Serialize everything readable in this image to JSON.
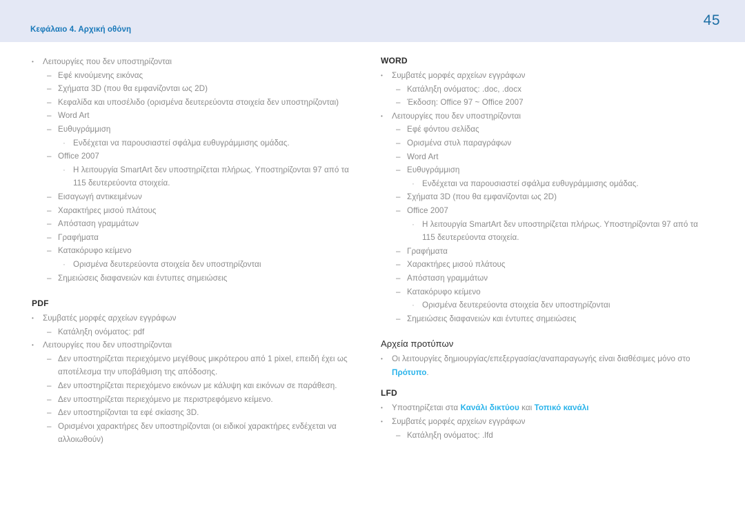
{
  "header": {
    "chapter": "Κεφάλαιο 4. Αρχική οθόνη",
    "page_number": "45",
    "band_color": "#e4e8f5",
    "chapter_color": "#1878b9",
    "page_number_color": "#1c6ea4"
  },
  "colors": {
    "body_text": "#8b8b8b",
    "heading_text": "#2b2b2b",
    "link": "#2ab3ea"
  },
  "left_column": {
    "unsupported_block": {
      "bullet": "Λειτουργίες που δεν υποστηρίζονται",
      "items": [
        "Εφέ κινούμενης εικόνας",
        "Σχήματα 3D (που θα εμφανίζονται ως 2D)",
        "Κεφαλίδα και υποσέλιδο (ορισμένα δευτερεύοντα στοιχεία δεν υποστηρίζονται)",
        "Word Art",
        "Ευθυγράμμιση"
      ],
      "align_note": "Ενδέχεται να παρουσιαστεί σφάλμα ευθυγράμμισης ομάδας.",
      "office": "Office 2007",
      "office_note": "Η λειτουργία SmartArt δεν υποστηρίζεται πλήρως. Υποστηρίζονται 97 από τα 115 δευτερεύοντα στοιχεία.",
      "items_after": [
        "Εισαγωγή αντικειμένων",
        "Χαρακτήρες μισού πλάτους",
        "Απόσταση γραμμάτων",
        "Γραφήματα",
        "Κατακόρυφο κείμενο"
      ],
      "vertical_text_note": "Ορισμένα δευτερεύοντα στοιχεία δεν υποστηρίζονται",
      "last_item": "Σημειώσεις διαφανειών και έντυπες σημειώσεις"
    },
    "pdf": {
      "heading": "PDF",
      "formats_bullet": "Συμβατές μορφές αρχείων εγγράφων",
      "extension": "Κατάληξη ονόματος: pdf",
      "unsupported_bullet": "Λειτουργίες που δεν υποστηρίζονται",
      "unsupported_items": [
        "Δεν υποστηρίζεται περιεχόμενο μεγέθους μικρότερου από 1 pixel, επειδή έχει ως αποτέλεσμα την υποβάθμιση της απόδοσης.",
        "Δεν υποστηρίζεται περιεχόμενο εικόνων με κάλυψη και εικόνων σε παράθεση.",
        "Δεν υποστηρίζεται περιεχόμενο με περιστρεφόμενο κείμενο.",
        "Δεν υποστηρίζονται τα εφέ σκίασης 3D.",
        "Ορισμένοι χαρακτήρες δεν υποστηρίζονται (οι ειδικοί χαρακτήρες ενδέχεται να αλλοιωθούν)"
      ]
    }
  },
  "right_column": {
    "word": {
      "heading": "WORD",
      "formats_bullet": "Συμβατές μορφές αρχείων εγγράφων",
      "extension": "Κατάληξη ονόματος: .doc, .docx",
      "version": "Έκδοση: Office 97 ~ Office 2007",
      "unsupported_bullet": "Λειτουργίες που δεν υποστηρίζονται",
      "items": [
        "Εφέ φόντου σελίδας",
        "Ορισμένα στυλ παραγράφων",
        "Word Art",
        "Ευθυγράμμιση"
      ],
      "align_note": "Ενδέχεται να παρουσιαστεί σφάλμα ευθυγράμμισης ομάδας.",
      "shapes_3d": "Σχήματα 3D (που θα εμφανίζονται ως 2D)",
      "office": "Office 2007",
      "office_note": "Η λειτουργία SmartArt δεν υποστηρίζεται πλήρως. Υποστηρίζονται 97 από τα 115 δευτερεύοντα στοιχεία.",
      "items_after": [
        "Γραφήματα",
        "Χαρακτήρες μισού πλάτους",
        "Απόσταση γραμμάτων",
        "Κατακόρυφο κείμενο"
      ],
      "vertical_text_note": "Ορισμένα δευτερεύοντα στοιχεία δεν υποστηρίζονται",
      "last_item": "Σημειώσεις διαφανειών και έντυπες σημειώσεις"
    },
    "templates": {
      "heading": "Αρχεία προτύπων",
      "bullet_prefix": "Οι λειτουργίες δημιουργίας/επεξεργασίας/αναπαραγωγής είναι διαθέσιμες μόνο στο ",
      "link": "Πρότυπο",
      "bullet_suffix": "."
    },
    "lfd": {
      "heading": "LFD",
      "supported_prefix": "Υποστηρίζεται στα ",
      "link_1": "Κανάλι δικτύου",
      "supported_middle": " και ",
      "link_2": "Τοπικό κανάλι",
      "formats_bullet": "Συμβατές μορφές αρχείων εγγράφων",
      "extension": "Κατάληξη ονόματος: .lfd"
    }
  },
  "markers": {
    "level1": "•",
    "level2": "–",
    "level3": "·"
  }
}
